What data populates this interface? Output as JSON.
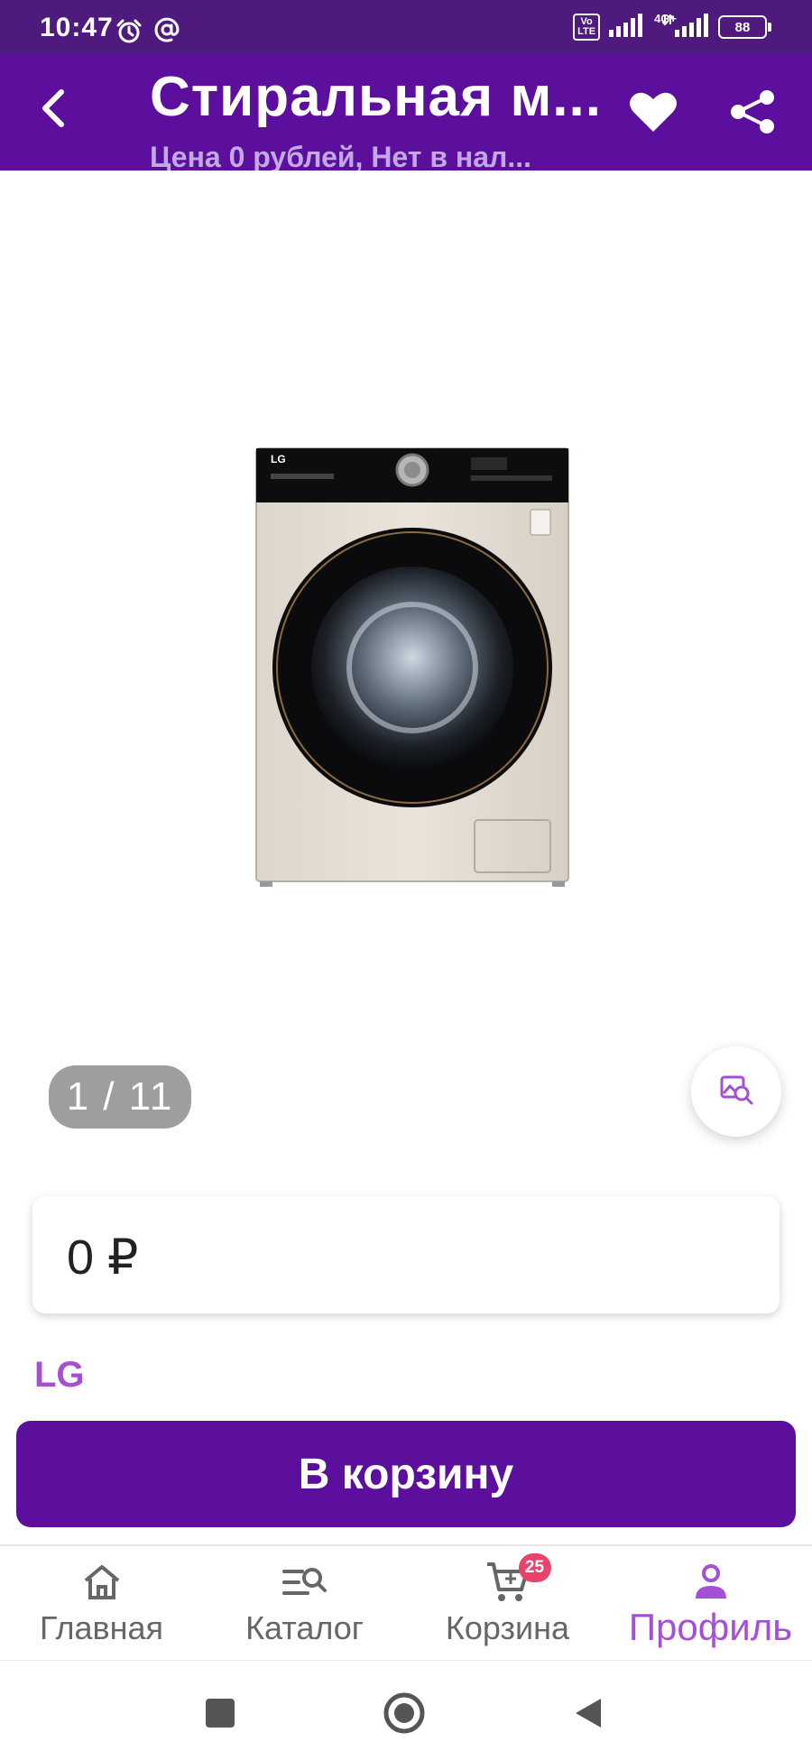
{
  "status_bar": {
    "time": "10:47",
    "volte_label": "Vo\nLTE",
    "network_label": "4G+",
    "battery_level": "88",
    "icons": [
      "alarm-icon",
      "at-icon",
      "signal-icon",
      "signal-icon"
    ]
  },
  "header": {
    "title": "Стиральная м...",
    "subtitle": "Цена 0 рублей, Нет в нал...",
    "back_icon": "chevron-left-icon",
    "favorite_icon": "heart-icon",
    "share_icon": "share-icon"
  },
  "gallery": {
    "counter": "1 / 11",
    "washer_brand_text": "LG",
    "zoom_icon": "image-search-icon"
  },
  "product": {
    "price": "0 ₽",
    "brand": "LG"
  },
  "actions": {
    "add_to_cart": "В корзину"
  },
  "bottom_nav": {
    "items": [
      {
        "label": "Главная",
        "icon": "home-icon",
        "active": false
      },
      {
        "label": "Каталог",
        "icon": "catalog-search-icon",
        "active": false
      },
      {
        "label": "Корзина",
        "icon": "cart-icon",
        "active": false,
        "badge": "25"
      },
      {
        "label": "Профиль",
        "icon": "person-icon",
        "active": true
      }
    ]
  },
  "system_nav": {
    "icons": [
      "recents-square-icon",
      "home-circle-icon",
      "back-triangle-icon"
    ]
  },
  "colors": {
    "status_bar": "#4f1a7e",
    "primary": "#5b0f9c",
    "accent": "#a54fd6",
    "badge": "#e8436b",
    "subtitle": "#c3a8e8"
  }
}
